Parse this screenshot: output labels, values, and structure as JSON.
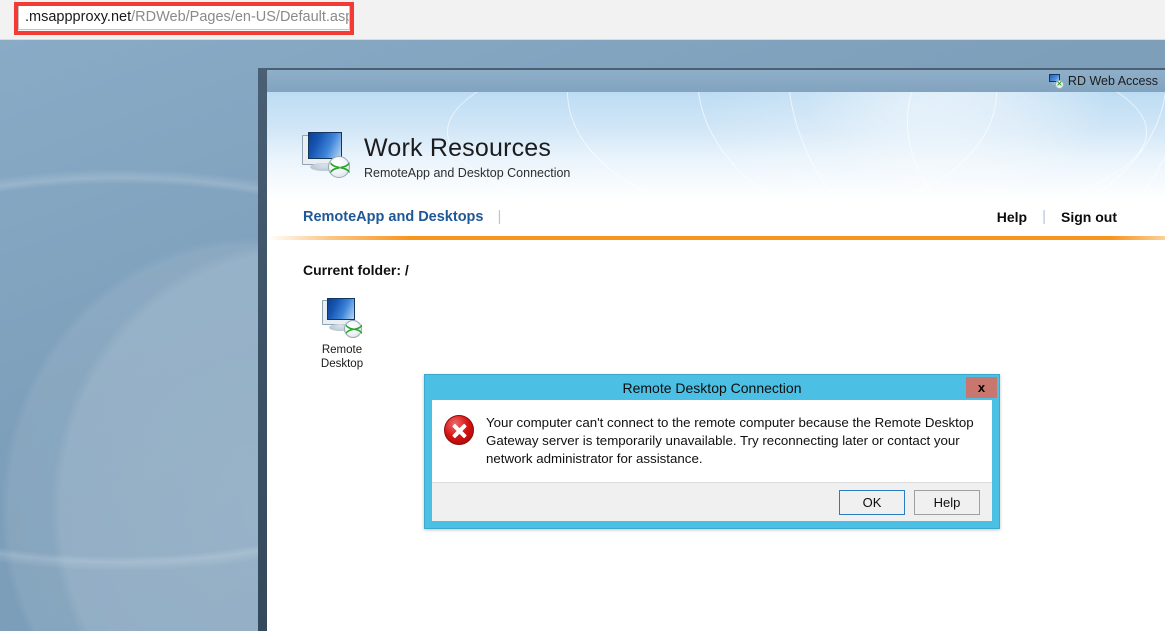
{
  "browser": {
    "url_host": ".msappproxy.net",
    "url_path": "/RDWeb/Pages/en-US/Default.aspx",
    "annotation_color": "#f33a33"
  },
  "rdweb": {
    "topbar": {
      "label": "RD Web Access",
      "icon": "rd-web-access-icon",
      "badge_glyph": "✕"
    },
    "brand": {
      "title": "Work Resources",
      "subtitle": "RemoteApp and Desktop Connection",
      "logo_badge_glyph": "≻≺"
    },
    "nav": {
      "tab_label": "RemoteApp and Desktops",
      "separator": "|",
      "help_label": "Help",
      "signout_label": "Sign out",
      "accent_color": "#f7941e"
    },
    "content": {
      "current_folder_label": "Current folder: /",
      "resources": [
        {
          "label_line1": "Remote",
          "label_line2": "Desktop",
          "icon": "remote-desktop-icon",
          "badge_glyph": "≻≺"
        }
      ]
    }
  },
  "dialog": {
    "title": "Remote Desktop Connection",
    "close_label": "x",
    "icon": "error-icon",
    "message": "Your computer can't connect to the remote computer because the Remote Desktop Gateway server is temporarily unavailable. Try reconnecting later or contact your network administrator for assistance.",
    "buttons": {
      "ok_label": "OK",
      "help_label": "Help"
    },
    "title_bar_color": "#4cc0e4",
    "close_button_color": "#c9776e"
  }
}
